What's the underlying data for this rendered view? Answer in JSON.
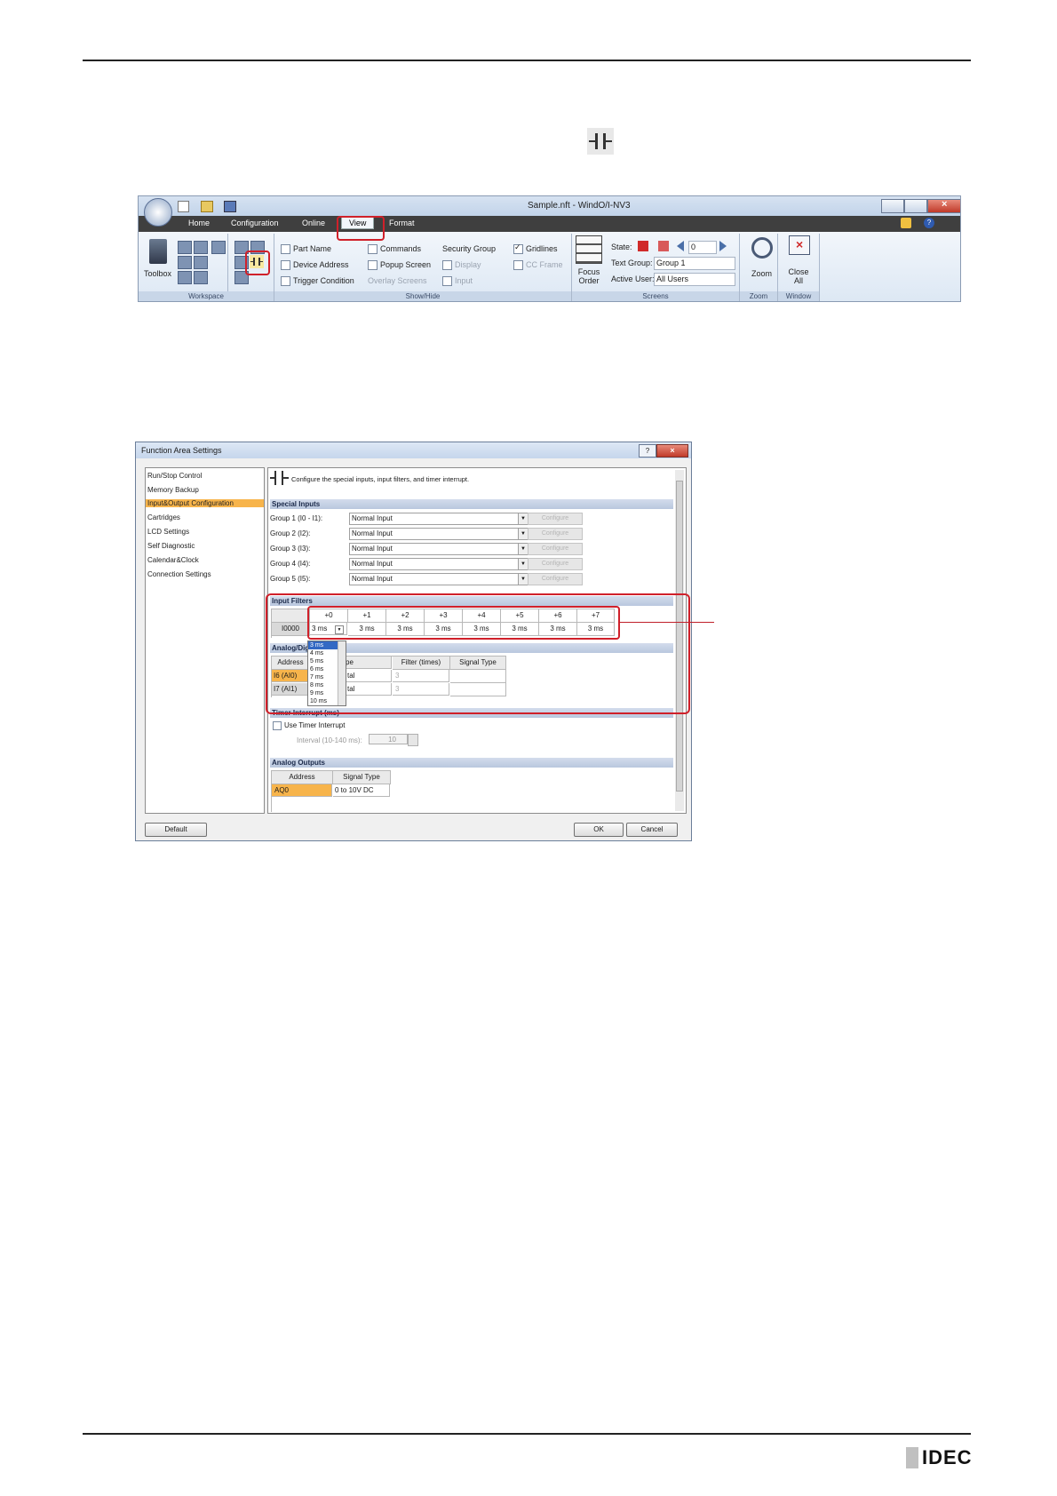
{
  "ribbon": {
    "title": "Sample.nft - WindO/I-NV3",
    "tabs": [
      "Home",
      "Configuration",
      "Online",
      "View",
      "Format"
    ],
    "active_tab": "View",
    "workspace": {
      "toolbox_label": "Toolbox",
      "group_label": "Workspace"
    },
    "showhide": {
      "part_name": "Part Name",
      "device_address": "Device Address",
      "trigger_condition": "Trigger Condition",
      "commands": "Commands",
      "popup_screen": "Popup Screen",
      "overlay_screens": "Overlay Screens",
      "security_group": "Security Group",
      "display": "Display",
      "input": "Input",
      "gridlines": "Gridlines",
      "cc_frame": "CC Frame",
      "group_label": "Show/Hide"
    },
    "screens": {
      "focus_order": "Focus Order",
      "state_label": "State:",
      "state_value": "0",
      "text_group_label": "Text Group:",
      "text_group_value": "Group 1",
      "active_user_label": "Active User:",
      "active_user_value": "All Users",
      "group_label": "Screens"
    },
    "zoom": {
      "label": "Zoom",
      "group_label": "Zoom"
    },
    "window": {
      "close_all": "Close All",
      "group_label": "Window"
    }
  },
  "dialog": {
    "title": "Function Area Settings",
    "nav": [
      "Run/Stop Control",
      "Memory Backup",
      "Input&Output Configuration",
      "Cartridges",
      "LCD Settings",
      "Self Diagnostic",
      "Calendar&Clock",
      "Connection Settings"
    ],
    "selected_nav": "Input&Output Configuration",
    "description": "Configure the special inputs, input filters, and timer interrupt.",
    "special_inputs": {
      "header": "Special Inputs",
      "configure": "Configure",
      "rows": [
        {
          "label": "Group 1 (I0 - I1):",
          "value": "Normal Input"
        },
        {
          "label": "Group 2 (I2):",
          "value": "Normal Input"
        },
        {
          "label": "Group 3 (I3):",
          "value": "Normal Input"
        },
        {
          "label": "Group 4 (I4):",
          "value": "Normal Input"
        },
        {
          "label": "Group 5 (I5):",
          "value": "Normal Input"
        }
      ]
    },
    "input_filters": {
      "header": "Input Filters",
      "columns": [
        "+0",
        "+1",
        "+2",
        "+3",
        "+4",
        "+5",
        "+6",
        "+7"
      ],
      "row_label": "I0000",
      "values": [
        "3 ms",
        "3 ms",
        "3 ms",
        "3 ms",
        "3 ms",
        "3 ms",
        "3 ms",
        "3 ms"
      ],
      "dropdown_options": [
        "3 ms",
        "4 ms",
        "5 ms",
        "6 ms",
        "7 ms",
        "8 ms",
        "9 ms",
        "10 ms"
      ]
    },
    "analog": {
      "header": "Analog/Dig",
      "col_address": "Address",
      "col_type": "pe",
      "col_filter": "Filter (times)",
      "col_signal": "Signal Type",
      "rows": [
        {
          "address": "I6 (AI0)",
          "type": "tal",
          "filter": "3"
        },
        {
          "address": "I7 (AI1)",
          "type": "tal",
          "filter": "3"
        }
      ]
    },
    "timer": {
      "header": "Timer Interrupt (ms)",
      "use_label": "Use Timer Interrupt",
      "interval_label": "Interval (10-140 ms):",
      "interval_value": "10"
    },
    "analog_outputs": {
      "header": "Analog Outputs",
      "col_address": "Address",
      "col_signal": "Signal Type",
      "rows": [
        {
          "address": "AQ0",
          "signal": "0 to 10V DC"
        }
      ]
    },
    "buttons": {
      "default": "Default",
      "ok": "OK",
      "cancel": "Cancel"
    }
  },
  "footer": {
    "logo": "IDEC"
  }
}
